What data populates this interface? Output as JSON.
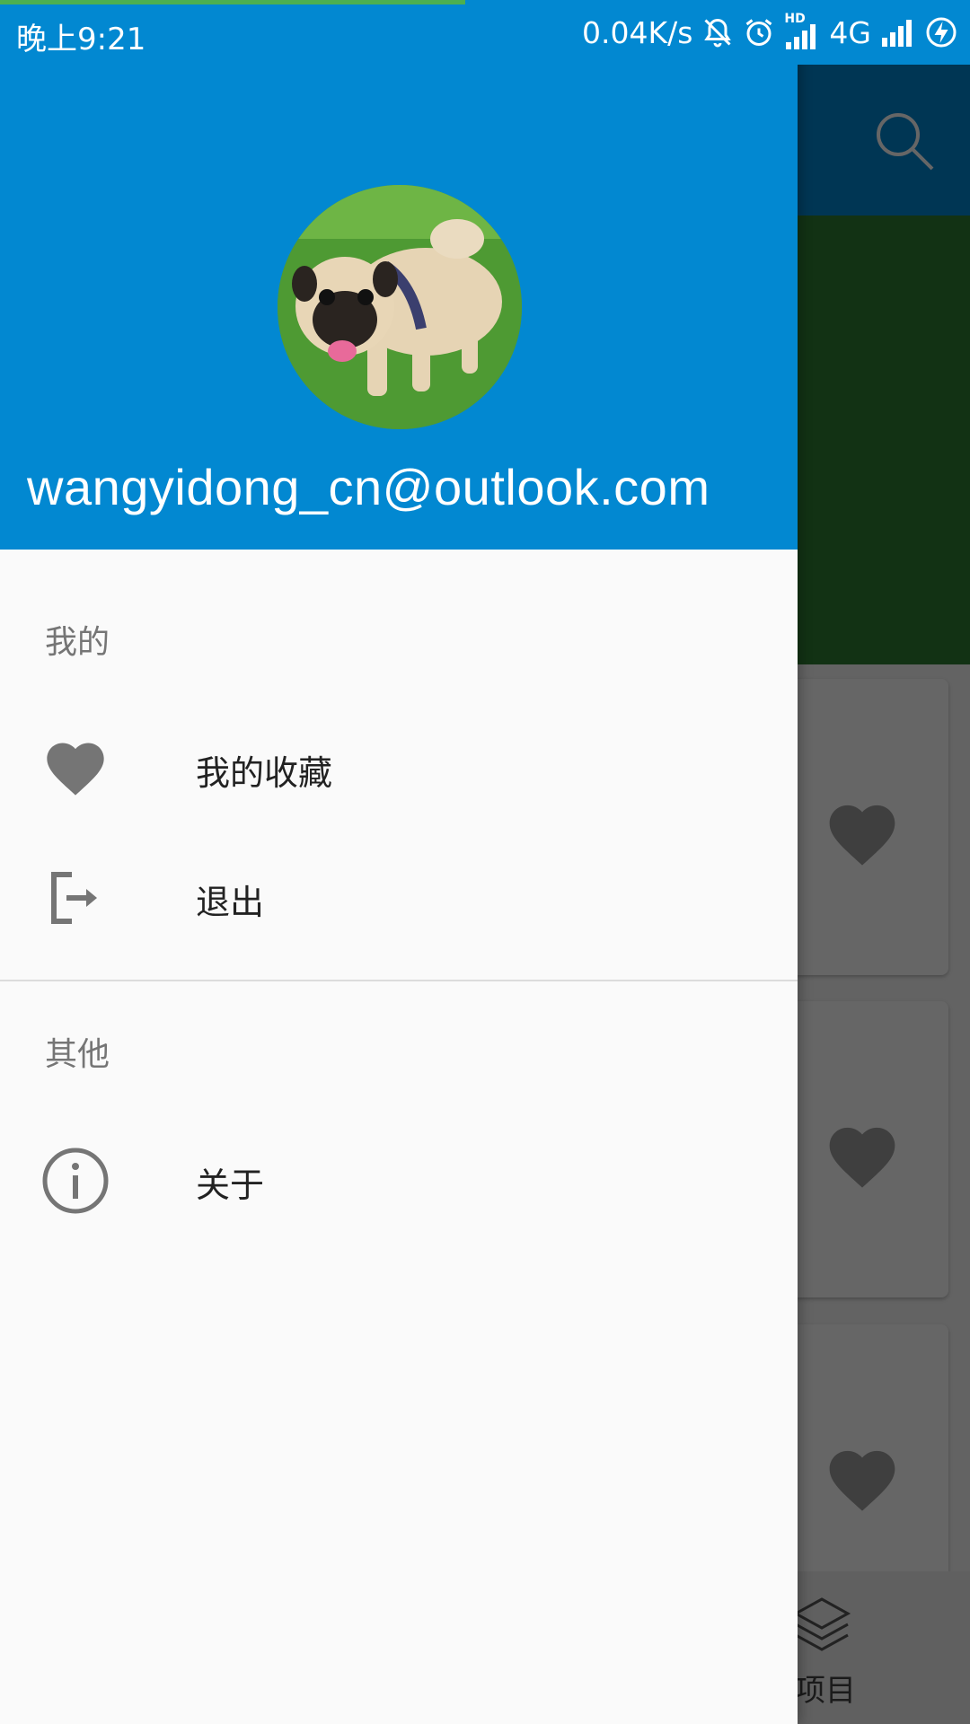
{
  "status_bar": {
    "time": "晚上9:21",
    "network_speed": "0.04K/s",
    "network_type": "4G",
    "hd_badge": "HD",
    "page_load_progress": 0.48
  },
  "background": {
    "bottom_nav_label": "项目"
  },
  "drawer": {
    "user_email": "wangyidong_cn@outlook.com",
    "sections": [
      {
        "title": "我的",
        "items": [
          {
            "label": "我的收藏",
            "icon": "heart-icon"
          },
          {
            "label": "退出",
            "icon": "logout-icon"
          }
        ]
      },
      {
        "title": "其他",
        "items": [
          {
            "label": "关于",
            "icon": "info-icon"
          }
        ]
      }
    ]
  },
  "colors": {
    "primary": "#0288d1",
    "progress": "#4caf50",
    "icon_gray": "#757575"
  }
}
